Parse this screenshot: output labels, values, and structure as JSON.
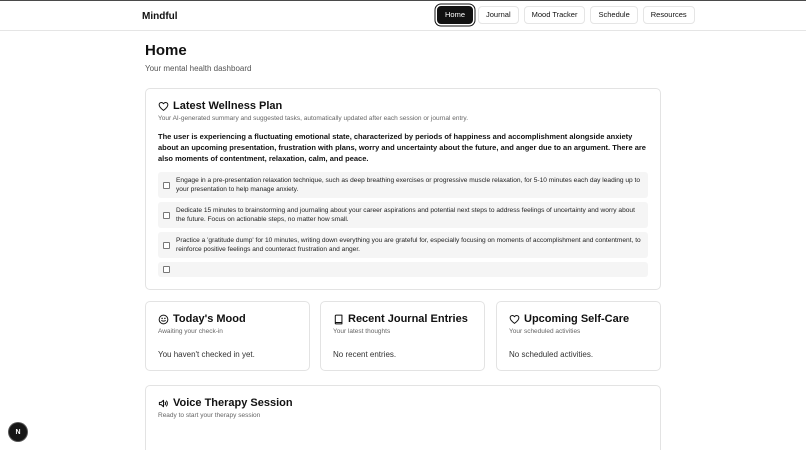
{
  "brand": "Mindful",
  "nav": {
    "home": "Home",
    "journal": "Journal",
    "mood_tracker": "Mood Tracker",
    "schedule": "Schedule",
    "resources": "Resources"
  },
  "page": {
    "title": "Home",
    "subtitle": "Your mental health dashboard"
  },
  "wellness": {
    "title": "Latest Wellness Plan",
    "subtitle": "Your AI-generated summary and suggested tasks, automatically updated after each session or journal entry.",
    "summary": "The user is experiencing a fluctuating emotional state, characterized by periods of happiness and accomplishment alongside anxiety about an upcoming presentation, frustration with plans, worry and uncertainty about the future, and anger due to an argument. There are also moments of contentment, relaxation, calm, and peace.",
    "tasks": [
      "Engage in a pre-presentation relaxation technique, such as deep breathing exercises or progressive muscle relaxation, for 5-10 minutes each day leading up to your presentation to help manage anxiety.",
      "Dedicate 15 minutes to brainstorming and journaling about your career aspirations and potential next steps to address feelings of uncertainty and worry about the future. Focus on actionable steps, no matter how small.",
      "Practice a 'gratitude dump' for 10 minutes, writing down everything you are grateful for, especially focusing on moments of accomplishment and contentment, to reinforce positive feelings and counteract frustration and anger.",
      ""
    ]
  },
  "mood": {
    "title": "Today's Mood",
    "subtitle": "Awaiting your check-in",
    "body": "You haven't checked in yet."
  },
  "journal": {
    "title": "Recent Journal Entries",
    "subtitle": "Your latest thoughts",
    "body": "No recent entries."
  },
  "selfcare": {
    "title": "Upcoming Self-Care",
    "subtitle": "Your scheduled activities",
    "body": "No scheduled activities."
  },
  "voice": {
    "title": "Voice Therapy Session",
    "subtitle": "Ready to start your therapy session"
  },
  "fab_label": "N",
  "icons": {
    "wellness": "heart-icon",
    "mood": "smile-icon",
    "journal": "book-icon",
    "selfcare": "heart-icon",
    "voice": "speaker-icon"
  }
}
